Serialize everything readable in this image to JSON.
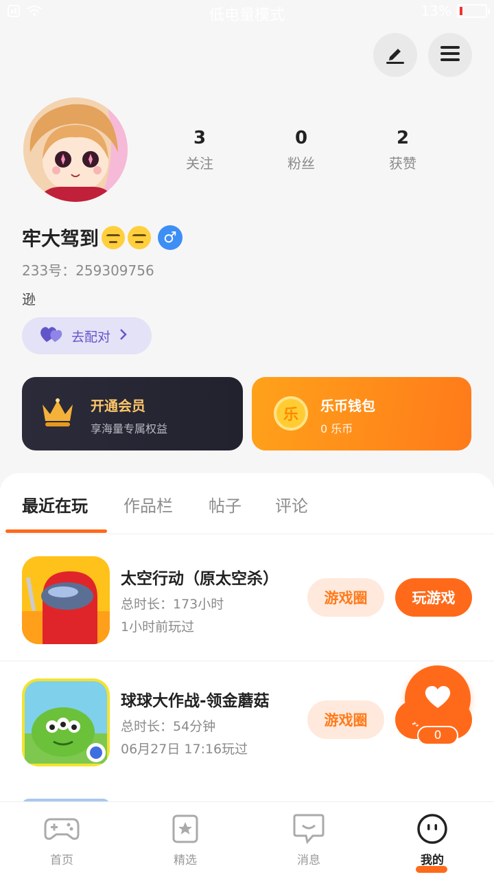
{
  "status_bar": {
    "center_text": "低电量模式",
    "battery_percent": "13%",
    "battery_level": 0.13
  },
  "profile": {
    "stats": [
      {
        "value": "3",
        "label": "关注"
      },
      {
        "value": "0",
        "label": "粉丝"
      },
      {
        "value": "2",
        "label": "获赞"
      }
    ],
    "username": "牢大驾到",
    "gender_symbol": "♂",
    "uid": "233号：259309756",
    "bio": "逊",
    "match_label": "去配对"
  },
  "cards": {
    "vip": {
      "title": "开通会员",
      "subtitle": "享海量专属权益"
    },
    "wallet": {
      "title": "乐币钱包",
      "subtitle": "0 乐币",
      "coin_glyph": "乐"
    }
  },
  "tabs": [
    {
      "label": "最近在玩",
      "active": true
    },
    {
      "label": "作品栏",
      "active": false
    },
    {
      "label": "帖子",
      "active": false
    },
    {
      "label": "评论",
      "active": false
    }
  ],
  "games": [
    {
      "title": "太空行动（原太空杀）",
      "duration": "总时长：173小时",
      "last_played": "1小时前玩过",
      "circle_label": "游戏圈",
      "play_label": "玩游戏"
    },
    {
      "title": "球球大作战-领金蘑菇",
      "duration": "总时长：54分钟",
      "last_played": "06月27日 17:16玩过",
      "circle_label": "游戏圈",
      "play_label": "玩游戏"
    }
  ],
  "fab": {
    "count": "0"
  },
  "bottom_nav": [
    {
      "label": "首页",
      "icon": "gamepad-icon"
    },
    {
      "label": "精选",
      "icon": "star-badge-icon"
    },
    {
      "label": "消息",
      "icon": "message-icon"
    },
    {
      "label": "我的",
      "icon": "face-icon",
      "active": true
    }
  ],
  "colors": {
    "accent": "#ff6a1a",
    "vip_gold": "#ffc76b",
    "gender_blue": "#3d8ef5",
    "match_purple": "#6255c9"
  }
}
